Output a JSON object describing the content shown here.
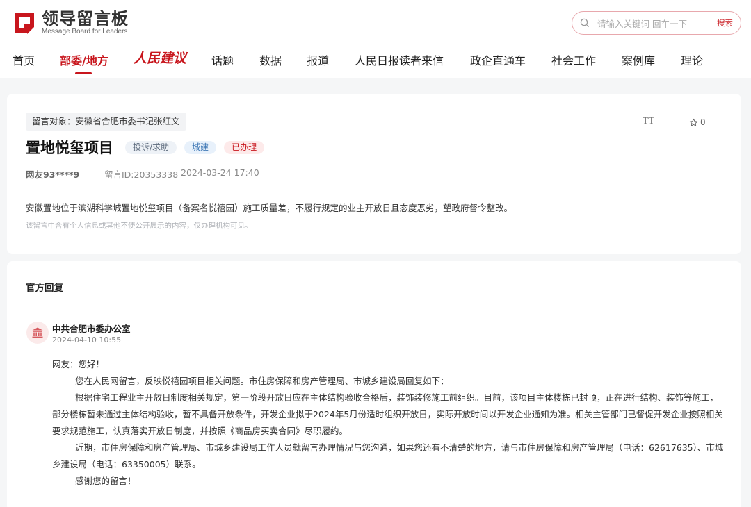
{
  "header": {
    "logo_title": "领导留言板",
    "logo_sub": "Message Board for Leaders",
    "search_placeholder": "请输入关键词 回车一下",
    "search_button": "搜索"
  },
  "nav": {
    "items": [
      "首页",
      "部委/地方",
      "人民建议",
      "话题",
      "数据",
      "报道",
      "人民日报读者来信",
      "政企直通车",
      "社会工作",
      "案例库",
      "理论"
    ],
    "active_index": 1
  },
  "message": {
    "target": "留言对象：安徽省合肥市委书记张红文",
    "title": "置地悦玺项目",
    "badges": [
      "投诉/求助",
      "城建",
      "已办理"
    ],
    "font_toggle": "TT",
    "favorites": "0",
    "user": "网友93****9",
    "id": "留言ID:20353338",
    "time": "2024-03-24 17:40",
    "body": "安徽置地位于滨湖科学城置地悦玺项目（备案名悦禧园）施工质量差，不履行规定的业主开放日且态度恶劣，望政府督令整改。",
    "note": "该留言中含有个人信息或其他不便公开展示的内容，仅办理机构可见。"
  },
  "reply": {
    "heading": "官方回复",
    "org": "中共合肥市委办公室",
    "time": "2024-04-10 10:55",
    "greeting": "网友：您好！",
    "p1": "您在人民网留言，反映悦禧园项目相关问题。市住房保障和房产管理局、市城乡建设局回复如下：",
    "p2": "根据住宅工程业主开放日制度相关规定，第一阶段开放日应在主体结构验收合格后，装饰装修施工前组织。目前，该项目主体楼栋已封顶，正在进行结构、装饰等施工，部分楼栋暂未通过主体结构验收，暂不具备开放条件，开发企业拟于2024年5月份适时组织开放日，实际开放时间以开发企业通知为准。相关主管部门已督促开发企业按照相关要求规范施工，认真落实开放日制度，并按照《商品房买卖合同》尽职履约。",
    "p3": "近期，市住房保障和房产管理局、市城乡建设局工作人员就留言办理情况与您沟通，如果您还有不清楚的地方，请与市住房保障和房产管理局（电话：62617635）、市城乡建设局（电话：63350005）联系。",
    "thanks": "感谢您的留言！"
  },
  "colors": {
    "brand": "#c8161d"
  }
}
